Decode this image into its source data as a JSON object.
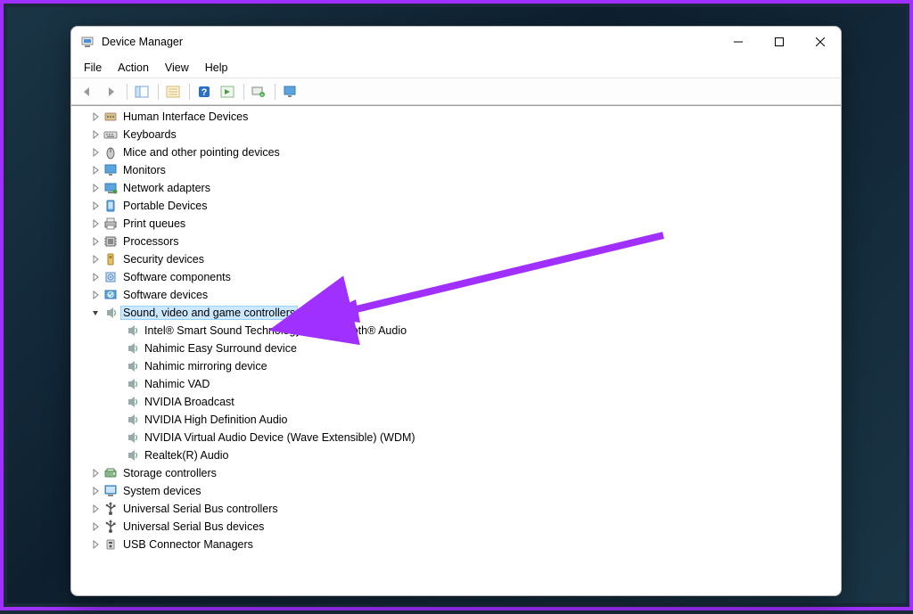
{
  "window": {
    "title": "Device Manager"
  },
  "menus": [
    "File",
    "Action",
    "View",
    "Help"
  ],
  "tree": [
    {
      "label": "Human Interface Devices",
      "icon": "hid",
      "expand": "collapsed"
    },
    {
      "label": "Keyboards",
      "icon": "keyboard",
      "expand": "collapsed"
    },
    {
      "label": "Mice and other pointing devices",
      "icon": "mouse",
      "expand": "collapsed"
    },
    {
      "label": "Monitors",
      "icon": "monitor",
      "expand": "collapsed"
    },
    {
      "label": "Network adapters",
      "icon": "network",
      "expand": "collapsed"
    },
    {
      "label": "Portable Devices",
      "icon": "portable",
      "expand": "collapsed"
    },
    {
      "label": "Print queues",
      "icon": "printer",
      "expand": "collapsed"
    },
    {
      "label": "Processors",
      "icon": "cpu",
      "expand": "collapsed"
    },
    {
      "label": "Security devices",
      "icon": "security",
      "expand": "collapsed"
    },
    {
      "label": "Software components",
      "icon": "swcomp",
      "expand": "collapsed"
    },
    {
      "label": "Software devices",
      "icon": "swdev",
      "expand": "collapsed"
    },
    {
      "label": "Sound, video and game controllers",
      "icon": "sound",
      "expand": "expanded",
      "selected": true,
      "children": [
        {
          "label": "Intel® Smart Sound Technology for Bluetooth® Audio",
          "icon": "sound"
        },
        {
          "label": "Nahimic Easy Surround device",
          "icon": "sound"
        },
        {
          "label": "Nahimic mirroring device",
          "icon": "sound"
        },
        {
          "label": "Nahimic VAD",
          "icon": "sound"
        },
        {
          "label": "NVIDIA Broadcast",
          "icon": "sound"
        },
        {
          "label": "NVIDIA High Definition Audio",
          "icon": "sound"
        },
        {
          "label": "NVIDIA Virtual Audio Device (Wave Extensible) (WDM)",
          "icon": "sound"
        },
        {
          "label": "Realtek(R) Audio",
          "icon": "sound"
        }
      ]
    },
    {
      "label": "Storage controllers",
      "icon": "storage",
      "expand": "collapsed"
    },
    {
      "label": "System devices",
      "icon": "system",
      "expand": "collapsed"
    },
    {
      "label": "Universal Serial Bus controllers",
      "icon": "usb",
      "expand": "collapsed"
    },
    {
      "label": "Universal Serial Bus devices",
      "icon": "usb",
      "expand": "collapsed"
    },
    {
      "label": "USB Connector Managers",
      "icon": "usbconn",
      "expand": "collapsed"
    }
  ],
  "annotation": {
    "color": "#a030ff"
  }
}
